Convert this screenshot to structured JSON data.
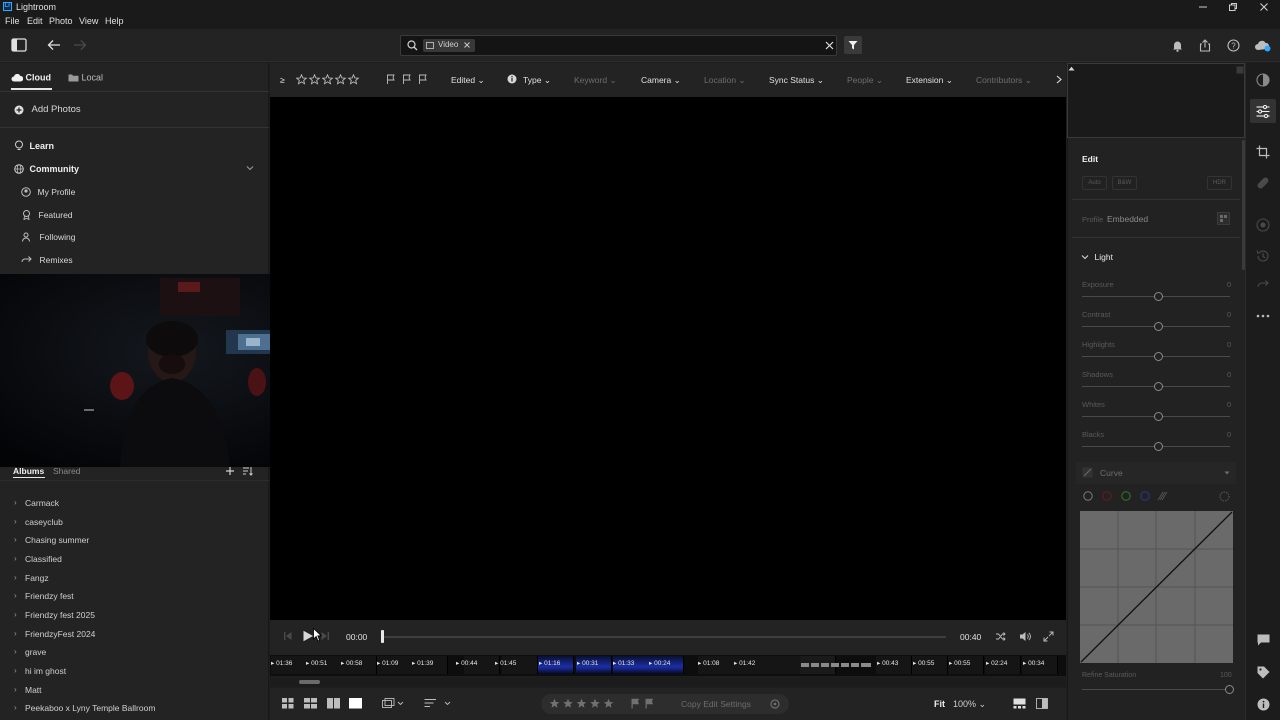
{
  "window": {
    "app_logo": "Lr",
    "title": "Lightroom"
  },
  "menu": [
    "File",
    "Edit",
    "Photo",
    "View",
    "Help"
  ],
  "search": {
    "chip_label": "Video"
  },
  "left_panel": {
    "tabs": {
      "cloud": "Cloud",
      "local": "Local"
    },
    "add_photos": "Add Photos",
    "learn": "Learn",
    "community": "Community",
    "community_items": [
      "My Profile",
      "Featured",
      "Following",
      "Remixes"
    ],
    "albums_tab": "Albums",
    "shared_tab": "Shared",
    "albums": [
      "Carmack",
      "caseyclub",
      "Chasing summer",
      "Classified",
      "Fangz",
      "Friendzy fest",
      "Friendzy fest 2025",
      "FriendzyFest 2024",
      "grave",
      "hi im ghost",
      "Matt",
      "Peekaboo x Lyny Temple Ballroom"
    ]
  },
  "filter_bar": {
    "rating_op": "≥",
    "edited": "Edited",
    "type": "Type",
    "keyword": "Keyword",
    "camera": "Camera",
    "location": "Location",
    "sync_status": "Sync Status",
    "people": "People",
    "extension": "Extension",
    "contributors": "Contributors"
  },
  "video": {
    "current_time": "00:00",
    "duration": "00:40",
    "progress": 0.0
  },
  "filmstrip": [
    "01:36",
    "00:51",
    "00:58",
    "01:09",
    "01:39",
    "00:44",
    "01:45",
    "01:16",
    "00:31",
    "01:33",
    "00:24",
    "01:08",
    "01:42",
    "",
    "",
    "00:43",
    "00:55",
    "00:55",
    "02:24",
    "00:34"
  ],
  "bottom_bar": {
    "copy_edit": "Copy Edit Settings",
    "fit": "Fit",
    "zoom": "100%"
  },
  "edit_panel": {
    "title": "Edit",
    "auto": "Auto",
    "bw": "B&W",
    "hdr": "HDR",
    "profile_label": "Profile",
    "profile_value": "Embedded",
    "light_title": "Light",
    "sliders": [
      {
        "label": "Exposure",
        "value": "0"
      },
      {
        "label": "Contrast",
        "value": "0"
      },
      {
        "label": "Highlights",
        "value": "0"
      },
      {
        "label": "Shadows",
        "value": "0"
      },
      {
        "label": "Whites",
        "value": "0"
      },
      {
        "label": "Blacks",
        "value": "0"
      }
    ],
    "curve_title": "Curve",
    "refine_saturation": "Refine Saturation",
    "refine_value": "100"
  },
  "colors": {
    "accent": "#31a8ff",
    "panel": "#232323",
    "viewer": "#000000"
  }
}
